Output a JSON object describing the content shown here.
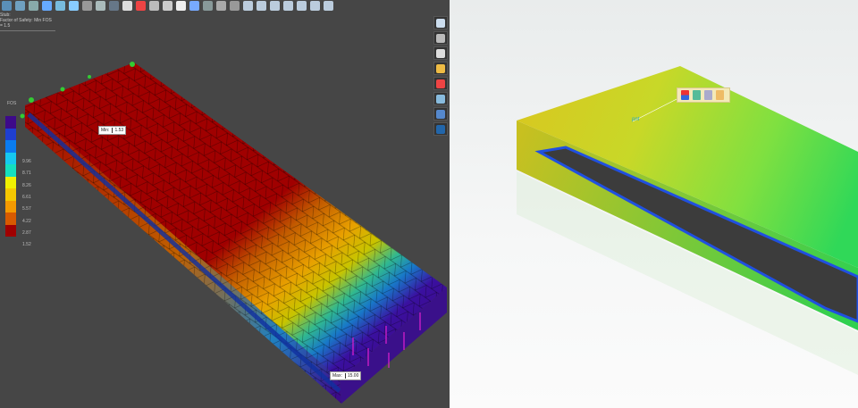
{
  "left_viewport": {
    "study_label": "Stub:",
    "study_name": "Factor of Safety: Min FOS = 1.5",
    "toolbar_icons": [
      "zoom-fit-icon",
      "zoom-area-icon",
      "previous-view-icon",
      "section-view-icon",
      "view-orientation-icon",
      "display-style-icon",
      "hide-show-icon",
      "edit-appearance-icon",
      "scene-icon",
      "view-settings-icon",
      "render-tools-icon",
      "monitor-icon",
      "toolbox-icon",
      "decal-icon",
      "sketch-icon",
      "line-icon",
      "trim-icon",
      "smart-dimension-icon",
      "layout-1-icon",
      "layout-2-icon",
      "layout-3-icon",
      "layout-4-icon",
      "layout-5-icon",
      "layout-6-icon",
      "layout-7-icon"
    ],
    "side_toolbar_icons": [
      "home-icon",
      "parts-icon",
      "open-folder-icon",
      "design-library-icon",
      "appearances-icon",
      "properties-icon",
      "refresh-icon",
      "simulation-icon"
    ],
    "legend": {
      "title": "FOS",
      "colors": [
        "#3d0a8a",
        "#1f3fd0",
        "#0a7cf0",
        "#16c9f0",
        "#14e0c0",
        "#f0f000",
        "#f6c800",
        "#f59a00",
        "#d85a00",
        "#a00000"
      ],
      "values": [
        "9.96",
        "8.71",
        "8.26",
        "6.61",
        "5.57",
        "4.22",
        "2.87",
        "1.52"
      ]
    },
    "min_tag": {
      "label": "Min:",
      "value": "1.53"
    },
    "max_tag": {
      "label": "Max:",
      "value": "15.00"
    }
  },
  "right_viewport": {
    "context_toolbar_icons": [
      "plot-color-icon",
      "deformed-shape-icon",
      "edit-definition-icon",
      "probe-settings-icon"
    ],
    "probe_label": "pnt"
  }
}
